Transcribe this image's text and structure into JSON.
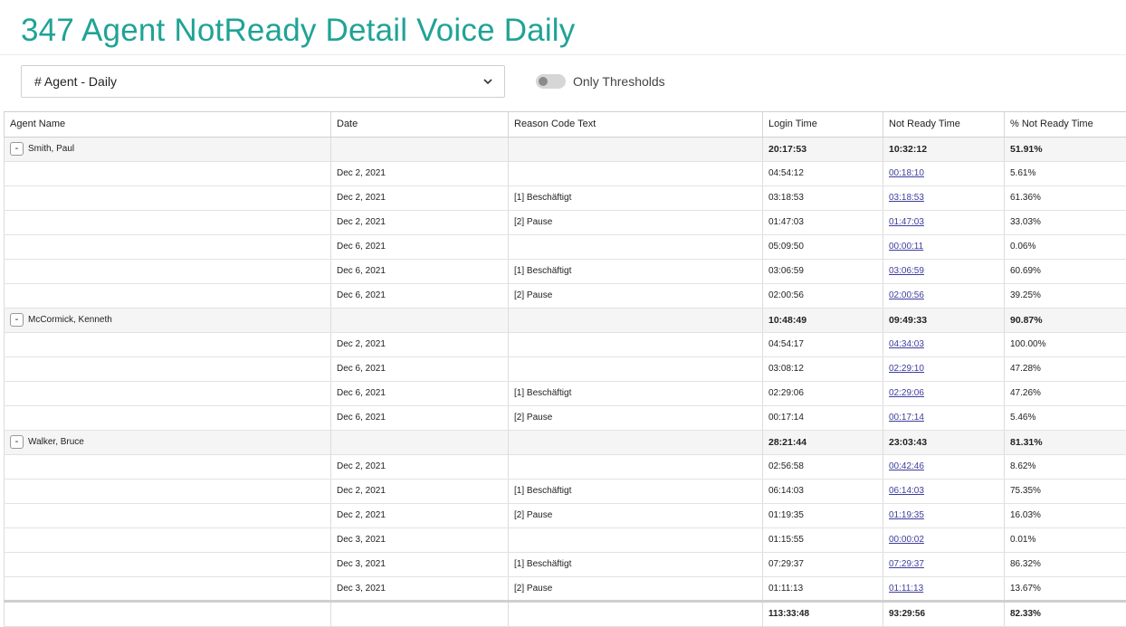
{
  "title": "347 Agent NotReady Detail Voice Daily",
  "filter": {
    "selected": "# Agent - Daily",
    "icon": "chevron-down-icon"
  },
  "toggle": {
    "label": "Only Thresholds",
    "on": false
  },
  "columns": [
    "Agent Name",
    "Date",
    "Reason Code Text",
    "Login Time",
    "Not Ready Time",
    "% Not Ready Time"
  ],
  "groups": [
    {
      "agent": "Smith, Paul",
      "expander": "-",
      "summary": {
        "login": "20:17:53",
        "not_ready": "10:32:12",
        "pct": "51.91%"
      },
      "rows": [
        {
          "date": "Dec 2, 2021",
          "reason": "",
          "login": "04:54:12",
          "not_ready": "00:18:10",
          "pct": "5.61%"
        },
        {
          "date": "Dec 2, 2021",
          "reason": "[1] Beschäftigt",
          "login": "03:18:53",
          "not_ready": "03:18:53",
          "pct": "61.36%"
        },
        {
          "date": "Dec 2, 2021",
          "reason": "[2] Pause",
          "login": "01:47:03",
          "not_ready": "01:47:03",
          "pct": "33.03%"
        },
        {
          "date": "Dec 6, 2021",
          "reason": "",
          "login": "05:09:50",
          "not_ready": "00:00:11",
          "pct": "0.06%"
        },
        {
          "date": "Dec 6, 2021",
          "reason": "[1] Beschäftigt",
          "login": "03:06:59",
          "not_ready": "03:06:59",
          "pct": "60.69%"
        },
        {
          "date": "Dec 6, 2021",
          "reason": "[2] Pause",
          "login": "02:00:56",
          "not_ready": "02:00:56",
          "pct": "39.25%"
        }
      ]
    },
    {
      "agent": "McCormick, Kenneth",
      "expander": "-",
      "summary": {
        "login": "10:48:49",
        "not_ready": "09:49:33",
        "pct": "90.87%"
      },
      "rows": [
        {
          "date": "Dec 2, 2021",
          "reason": "",
          "login": "04:54:17",
          "not_ready": "04:34:03",
          "pct": "100.00%"
        },
        {
          "date": "Dec 6, 2021",
          "reason": "",
          "login": "03:08:12",
          "not_ready": "02:29:10",
          "pct": "47.28%"
        },
        {
          "date": "Dec 6, 2021",
          "reason": "[1] Beschäftigt",
          "login": "02:29:06",
          "not_ready": "02:29:06",
          "pct": "47.26%"
        },
        {
          "date": "Dec 6, 2021",
          "reason": "[2] Pause",
          "login": "00:17:14",
          "not_ready": "00:17:14",
          "pct": "5.46%"
        }
      ]
    },
    {
      "agent": "Walker, Bruce",
      "expander": "-",
      "summary": {
        "login": "28:21:44",
        "not_ready": "23:03:43",
        "pct": "81.31%"
      },
      "rows": [
        {
          "date": "Dec 2, 2021",
          "reason": "",
          "login": "02:56:58",
          "not_ready": "00:42:46",
          "pct": "8.62%"
        },
        {
          "date": "Dec 2, 2021",
          "reason": "[1] Beschäftigt",
          "login": "06:14:03",
          "not_ready": "06:14:03",
          "pct": "75.35%"
        },
        {
          "date": "Dec 2, 2021",
          "reason": "[2] Pause",
          "login": "01:19:35",
          "not_ready": "01:19:35",
          "pct": "16.03%"
        },
        {
          "date": "Dec 3, 2021",
          "reason": "",
          "login": "01:15:55",
          "not_ready": "00:00:02",
          "pct": "0.01%"
        },
        {
          "date": "Dec 3, 2021",
          "reason": "[1] Beschäftigt",
          "login": "07:29:37",
          "not_ready": "07:29:37",
          "pct": "86.32%"
        },
        {
          "date": "Dec 3, 2021",
          "reason": "[2] Pause",
          "login": "01:11:13",
          "not_ready": "01:11:13",
          "pct": "13.67%"
        }
      ]
    }
  ],
  "total": {
    "login": "113:33:48",
    "not_ready": "93:29:56",
    "pct": "82.33%"
  }
}
